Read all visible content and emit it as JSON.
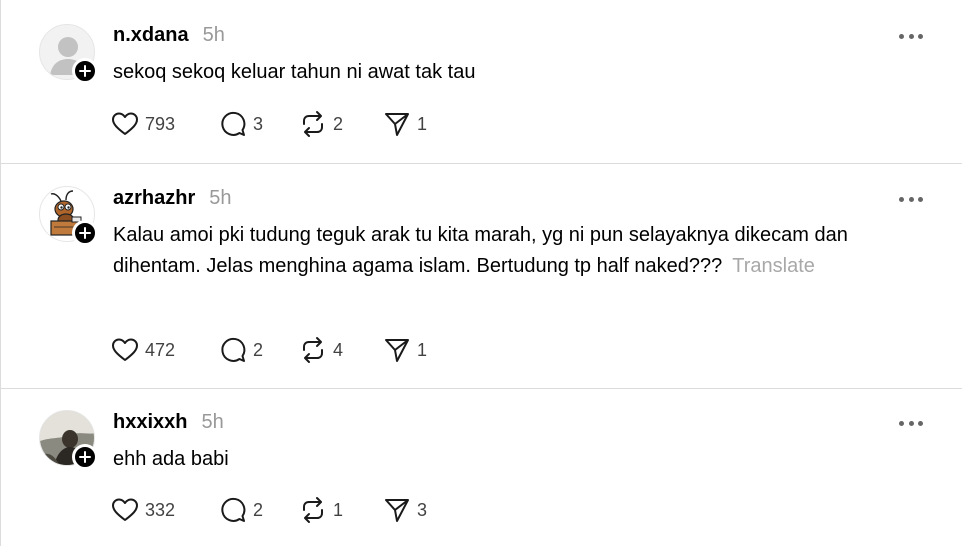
{
  "posts": [
    {
      "username": "n.xdana",
      "time": "5h",
      "text": "sekoq sekoq keluar tahun ni awat tak tau",
      "translate": "",
      "avatar": "default-person-avatar",
      "likes": "793",
      "replies": "3",
      "reposts": "2",
      "shares": "1"
    },
    {
      "username": "azrhazhr",
      "time": "5h",
      "text": "Kalau amoi pki tudung teguk arak tu kita marah, yg ni pun selayaknya dikecam dan dihentam. Jelas menghina agama islam. Bertudung tp half naked???",
      "translate": "Translate",
      "avatar": "cartoon-bug-at-desk-avatar",
      "likes": "472",
      "replies": "2",
      "reposts": "4",
      "shares": "1"
    },
    {
      "username": "hxxixxh",
      "time": "5h",
      "text": "ehh ada babi",
      "translate": "",
      "avatar": "photo-avatar",
      "likes": "332",
      "replies": "2",
      "reposts": "1",
      "shares": "3"
    }
  ],
  "icons": {
    "like": "heart-icon",
    "reply": "comment-icon",
    "repost": "repost-icon",
    "share": "send-icon",
    "more": "more-options-icon",
    "follow": "plus-icon"
  },
  "colors": {
    "text": "#000000",
    "muted": "#999999",
    "divider": "#dcdcdc"
  }
}
